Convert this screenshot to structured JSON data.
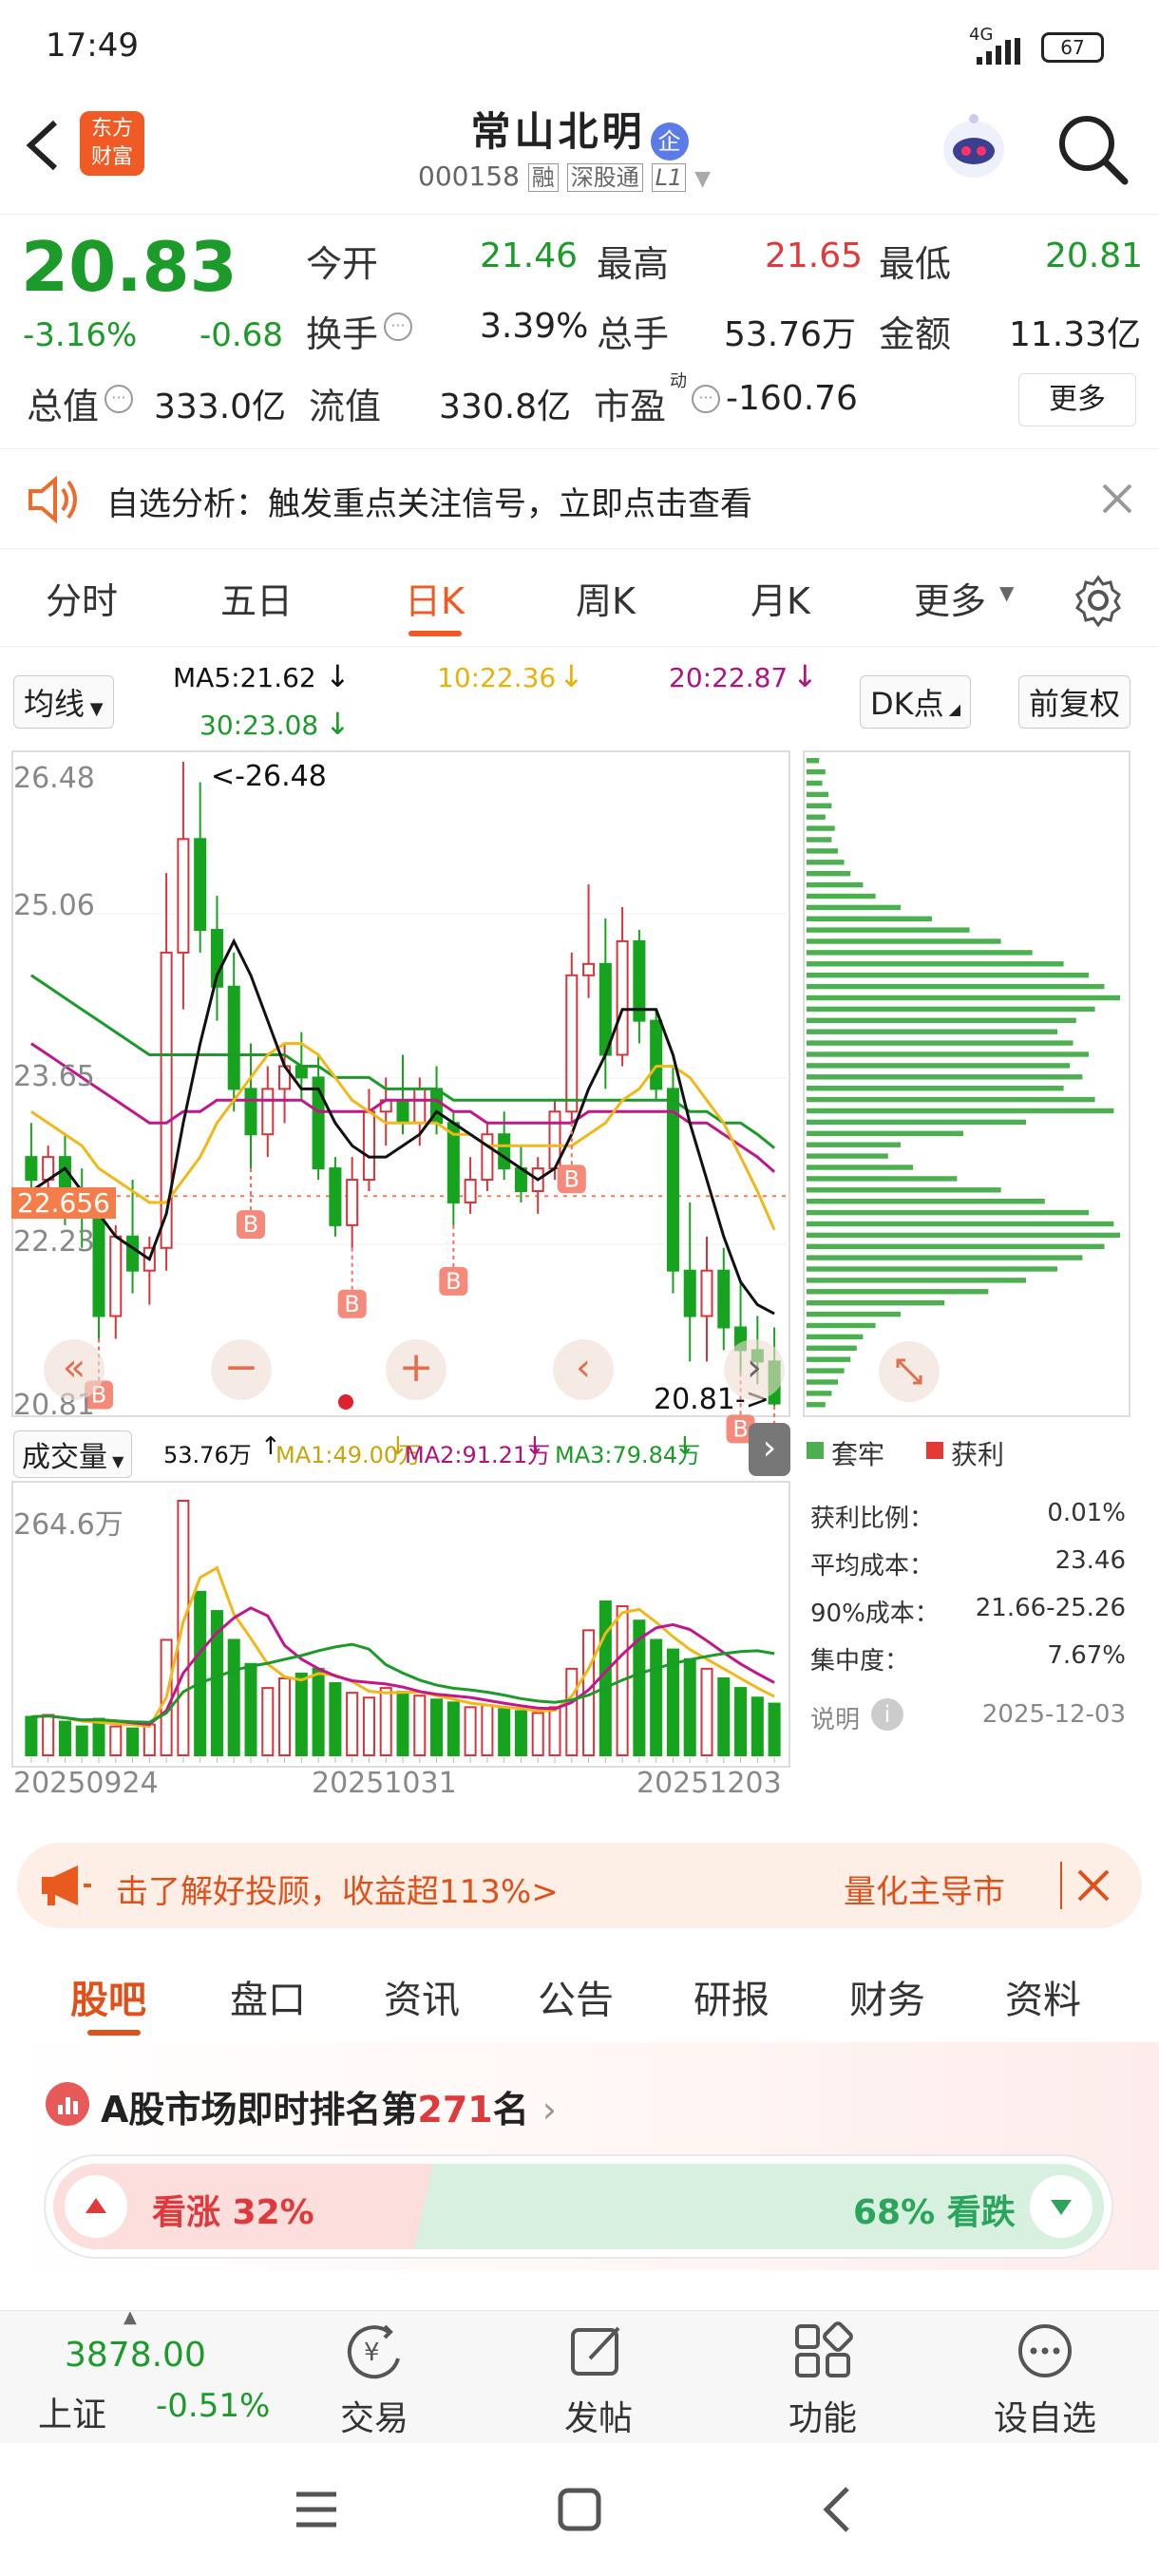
{
  "status": {
    "time": "17:49",
    "network": "4G",
    "battery": "67"
  },
  "header": {
    "logo_line1": "东方",
    "logo_line2": "财富",
    "stock_name": "常山北明",
    "badge": "企",
    "code": "000158",
    "tag1": "融",
    "tag2": "深股通",
    "tag3": "L1"
  },
  "quote": {
    "price": "20.83",
    "change_pct": "-3.16%",
    "change": "-0.68",
    "rows": [
      [
        {
          "label": "今开",
          "value": "21.46",
          "color": "green"
        },
        {
          "label": "最高",
          "value": "21.65",
          "color": "red"
        },
        {
          "label": "最低",
          "value": "20.81",
          "color": "green"
        }
      ],
      [
        {
          "label": "换手",
          "value": "3.39%",
          "color": "dark"
        },
        {
          "label": "总手",
          "value": "53.76万",
          "color": "dark"
        },
        {
          "label": "金额",
          "value": "11.33亿",
          "color": "dark"
        }
      ],
      [
        {
          "label": "总值",
          "value": "333.0亿",
          "color": "dark"
        },
        {
          "label": "流值",
          "value": "330.8亿",
          "color": "dark"
        },
        {
          "label": "市盈",
          "value": "-160.76",
          "color": "dark"
        }
      ]
    ],
    "more_label": "更多",
    "pe_sup": "动"
  },
  "banner": {
    "text": "自选分析：触发重点关注信号，立即点击查看"
  },
  "ktabs": [
    "分时",
    "五日",
    "日K",
    "周K",
    "月K",
    "更多"
  ],
  "ma_row": {
    "selector": "均线",
    "ma5": "MA5:21.62",
    "ma10": "10:22.36",
    "ma20": "20:22.87",
    "ma30": "30:23.08",
    "dk": "DK点",
    "adjust": "前复权"
  },
  "chart": {
    "y_labels": [
      "26.48",
      "25.06",
      "23.65",
      "22.23",
      "20.81"
    ],
    "max_label": "<-26.48",
    "min_label": "20.81->",
    "current_price_tag": "22.656",
    "b_mark": "B",
    "vol_selector": "成交量",
    "vol_legend": {
      "vol": "53.76万",
      "ma1": "MA1:49.00万",
      "ma2": "MA2:91.21万",
      "ma3": "MA3:79.84万"
    },
    "vol_max": "264.6万",
    "dates": [
      "20250924",
      "20251031",
      "20251203"
    ]
  },
  "chart_data": {
    "type": "candlestick",
    "ylim": [
      20.81,
      26.48
    ],
    "candles": [
      [
        23.0,
        23.3,
        22.5,
        22.8
      ],
      [
        22.8,
        23.1,
        22.6,
        23.0
      ],
      [
        23.0,
        23.2,
        22.4,
        22.6
      ],
      [
        22.6,
        22.9,
        22.2,
        22.5
      ],
      [
        22.5,
        22.6,
        21.4,
        21.6
      ],
      [
        21.6,
        22.4,
        21.4,
        22.3
      ],
      [
        22.3,
        22.8,
        21.8,
        22.0
      ],
      [
        22.0,
        22.3,
        21.7,
        22.2
      ],
      [
        22.2,
        25.5,
        22.0,
        24.8
      ],
      [
        24.8,
        26.48,
        24.3,
        25.8
      ],
      [
        25.8,
        26.3,
        24.8,
        25.0
      ],
      [
        25.0,
        25.3,
        24.2,
        24.5
      ],
      [
        24.5,
        24.8,
        23.4,
        23.6
      ],
      [
        23.6,
        24.0,
        22.9,
        23.2
      ],
      [
        23.2,
        23.8,
        23.0,
        23.6
      ],
      [
        23.6,
        24.0,
        23.3,
        23.8
      ],
      [
        23.8,
        24.1,
        23.5,
        23.7
      ],
      [
        23.7,
        23.9,
        22.8,
        22.9
      ],
      [
        22.9,
        23.0,
        22.3,
        22.4
      ],
      [
        22.4,
        23.0,
        22.2,
        22.8
      ],
      [
        22.8,
        23.6,
        22.7,
        23.4
      ],
      [
        23.4,
        23.7,
        23.1,
        23.5
      ],
      [
        23.5,
        23.9,
        23.2,
        23.3
      ],
      [
        23.3,
        23.7,
        23.1,
        23.6
      ],
      [
        23.6,
        23.8,
        23.2,
        23.3
      ],
      [
        23.3,
        23.4,
        22.4,
        22.6
      ],
      [
        22.6,
        23.0,
        22.5,
        22.8
      ],
      [
        22.8,
        23.3,
        22.7,
        23.2
      ],
      [
        23.2,
        23.4,
        22.8,
        22.9
      ],
      [
        22.9,
        23.1,
        22.6,
        22.7
      ],
      [
        22.7,
        23.0,
        22.5,
        22.9
      ],
      [
        22.9,
        23.5,
        22.8,
        23.4
      ],
      [
        23.4,
        24.8,
        23.3,
        24.6
      ],
      [
        24.6,
        25.4,
        24.4,
        24.7
      ],
      [
        24.7,
        25.1,
        23.6,
        23.9
      ],
      [
        23.9,
        25.2,
        23.8,
        24.9
      ],
      [
        24.9,
        25.0,
        24.0,
        24.2
      ],
      [
        24.2,
        24.3,
        23.5,
        23.6
      ],
      [
        23.6,
        23.8,
        21.8,
        22.0
      ],
      [
        22.0,
        22.6,
        21.2,
        21.6
      ],
      [
        21.6,
        22.3,
        21.2,
        22.0
      ],
      [
        22.0,
        22.2,
        21.3,
        21.5
      ],
      [
        21.5,
        21.9,
        21.1,
        21.3
      ],
      [
        21.3,
        21.6,
        21.0,
        21.2
      ],
      [
        21.2,
        21.5,
        20.81,
        20.83
      ]
    ],
    "ma5": [
      22.7,
      22.8,
      22.9,
      22.7,
      22.5,
      22.3,
      22.2,
      22.1,
      22.5,
      23.3,
      24.0,
      24.6,
      24.9,
      24.6,
      24.2,
      23.8,
      23.6,
      23.6,
      23.3,
      23.1,
      23.0,
      23.0,
      23.1,
      23.2,
      23.4,
      23.3,
      23.2,
      23.1,
      23.0,
      22.9,
      22.8,
      22.9,
      23.2,
      23.6,
      23.9,
      24.3,
      24.3,
      24.3,
      23.9,
      23.3,
      22.8,
      22.3,
      21.9,
      21.7,
      21.62
    ],
    "ma10": [
      23.4,
      23.3,
      23.2,
      23.1,
      22.9,
      22.8,
      22.7,
      22.6,
      22.6,
      22.8,
      23.0,
      23.3,
      23.5,
      23.7,
      23.9,
      24.0,
      24.0,
      23.9,
      23.7,
      23.5,
      23.4,
      23.3,
      23.3,
      23.3,
      23.3,
      23.2,
      23.2,
      23.1,
      23.1,
      23.1,
      23.1,
      23.1,
      23.1,
      23.2,
      23.3,
      23.5,
      23.6,
      23.8,
      23.8,
      23.7,
      23.5,
      23.3,
      23.0,
      22.7,
      22.36
    ],
    "ma20": [
      24.0,
      23.9,
      23.8,
      23.7,
      23.6,
      23.5,
      23.4,
      23.3,
      23.3,
      23.4,
      23.4,
      23.5,
      23.5,
      23.5,
      23.5,
      23.5,
      23.5,
      23.4,
      23.4,
      23.4,
      23.4,
      23.5,
      23.5,
      23.5,
      23.5,
      23.4,
      23.4,
      23.3,
      23.3,
      23.3,
      23.3,
      23.3,
      23.3,
      23.4,
      23.4,
      23.4,
      23.4,
      23.4,
      23.4,
      23.3,
      23.3,
      23.2,
      23.1,
      23.0,
      22.87
    ],
    "ma30": [
      24.6,
      24.5,
      24.4,
      24.3,
      24.2,
      24.1,
      24.0,
      23.9,
      23.9,
      23.9,
      23.9,
      23.9,
      23.9,
      23.9,
      23.9,
      23.9,
      23.8,
      23.8,
      23.7,
      23.7,
      23.7,
      23.6,
      23.6,
      23.6,
      23.6,
      23.5,
      23.5,
      23.5,
      23.5,
      23.5,
      23.5,
      23.5,
      23.5,
      23.5,
      23.5,
      23.5,
      23.5,
      23.5,
      23.5,
      23.4,
      23.4,
      23.3,
      23.3,
      23.2,
      23.08
    ],
    "volume": [
      40,
      42,
      35,
      30,
      38,
      30,
      28,
      32,
      120,
      264.6,
      170,
      150,
      120,
      95,
      70,
      80,
      85,
      90,
      75,
      65,
      60,
      70,
      66,
      62,
      58,
      55,
      50,
      52,
      48,
      46,
      44,
      50,
      90,
      130,
      160,
      155,
      140,
      120,
      110,
      100,
      90,
      80,
      70,
      60,
      53.76
    ],
    "vol_ylim": [
      0,
      264.6
    ],
    "b_signals": [
      4,
      13,
      19,
      25,
      32,
      42,
      44
    ]
  },
  "legend_dist": {
    "trapped": "套牢",
    "profit": "获利"
  },
  "cost": {
    "rows": [
      {
        "label": "获利比例：",
        "value": "0.01%"
      },
      {
        "label": "平均成本：",
        "value": "23.46"
      },
      {
        "label": "90%成本：",
        "value": "21.66-25.26"
      },
      {
        "label": "集中度：",
        "value": "7.67%"
      }
    ],
    "explain": "说明",
    "date": "2025-12-03"
  },
  "dist_bars": [
    0.04,
    0.06,
    0.05,
    0.07,
    0.08,
    0.06,
    0.09,
    0.08,
    0.1,
    0.12,
    0.14,
    0.18,
    0.22,
    0.3,
    0.4,
    0.52,
    0.62,
    0.72,
    0.82,
    0.9,
    0.95,
    1.0,
    0.92,
    0.86,
    0.8,
    0.85,
    0.9,
    0.84,
    0.88,
    0.82,
    0.92,
    0.98,
    0.7,
    0.5,
    0.3,
    0.26,
    0.34,
    0.48,
    0.62,
    0.76,
    0.9,
    0.98,
    1.0,
    0.95,
    0.88,
    0.8,
    0.7,
    0.58,
    0.44,
    0.3,
    0.22,
    0.18,
    0.16,
    0.14,
    0.12,
    0.1,
    0.08,
    0.06
  ],
  "ad": {
    "text": "击了解好投顾，收益超113%>",
    "sub": "量化主导市"
  },
  "btabs": [
    "股吧",
    "盘口",
    "资讯",
    "公告",
    "研报",
    "财务",
    "资料"
  ],
  "rank": {
    "title_prefix": "A股市场即时排名第",
    "rank_num": "271",
    "title_suffix": "名",
    "up_label": "看涨 32%",
    "down_label": "68% 看跌"
  },
  "bottomnav": {
    "index_value": "3878.00",
    "index_name": "上证",
    "index_change": "-0.51%",
    "items": [
      "交易",
      "发帖",
      "功能",
      "设自选"
    ]
  }
}
